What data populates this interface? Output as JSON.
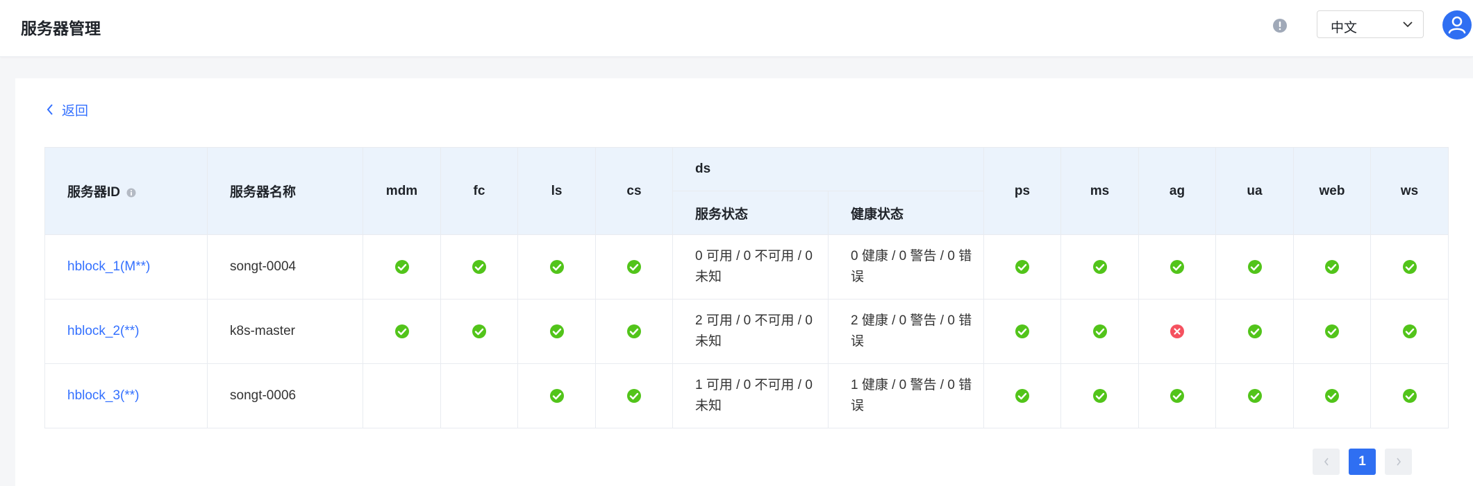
{
  "header": {
    "title": "服务器管理",
    "help_icon": "alert-circle-icon",
    "language": "中文",
    "avatar_icon": "user-avatar-icon"
  },
  "back": {
    "label": "返回",
    "icon": "chevron-left-icon"
  },
  "table": {
    "columns": {
      "server_id": "服务器ID",
      "server_name": "服务器名称",
      "mdm": "mdm",
      "fc": "fc",
      "ls": "ls",
      "cs": "cs",
      "ds": "ds",
      "ds_service_status": "服务状态",
      "ds_health_status": "健康状态",
      "ps": "ps",
      "ms": "ms",
      "ag": "ag",
      "ua": "ua",
      "web": "web",
      "ws": "ws"
    },
    "rows": [
      {
        "id": "hblock_1(M**)",
        "name": "songt-0004",
        "mdm": "ok",
        "fc": "ok",
        "ls": "ok",
        "cs": "ok",
        "ds_service": "0 可用 / 0 不可用 / 0 未知",
        "ds_health": "0 健康 / 0 警告 / 0 错误",
        "ps": "ok",
        "ms": "ok",
        "ag": "ok",
        "ua": "ok",
        "web": "ok",
        "ws": "ok"
      },
      {
        "id": "hblock_2(**)",
        "name": "k8s-master",
        "mdm": "ok",
        "fc": "ok",
        "ls": "ok",
        "cs": "ok",
        "ds_service": "2 可用 / 0 不可用 / 0 未知",
        "ds_health": "2 健康 / 0 警告 / 0 错误",
        "ps": "ok",
        "ms": "ok",
        "ag": "error",
        "ua": "ok",
        "web": "ok",
        "ws": "ok"
      },
      {
        "id": "hblock_3(**)",
        "name": "songt-0006",
        "mdm": "",
        "fc": "",
        "ls": "ok",
        "cs": "ok",
        "ds_service": "1 可用 / 0 不可用 / 0 未知",
        "ds_health": "1 健康 / 0 警告 / 0 错误",
        "ps": "ok",
        "ms": "ok",
        "ag": "ok",
        "ua": "ok",
        "web": "ok",
        "ws": "ok"
      }
    ]
  },
  "pagination": {
    "current": "1"
  },
  "colors": {
    "accent": "#3370ff",
    "ok": "#52c41a",
    "error": "#f5515f",
    "header_bg": "#ebf3fc"
  }
}
